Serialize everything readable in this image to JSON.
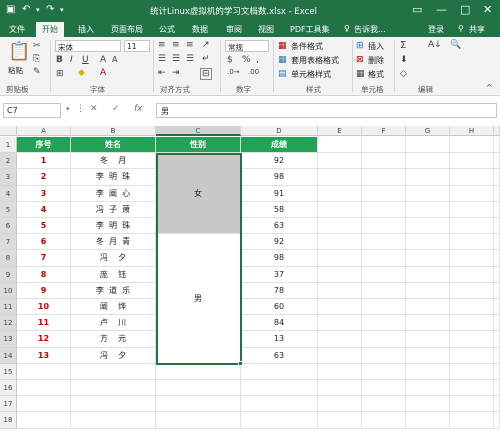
{
  "titlebar": {
    "title": "统计Linux虚拟机的学习文档数.xlsx - Excel",
    "save_icon": "save-icon",
    "undo_icon": "undo-icon",
    "redo_icon": "redo-icon"
  },
  "tabs": [
    "文件",
    "开始",
    "插入",
    "页面布局",
    "公式",
    "数据",
    "审阅",
    "视图",
    "PDF工具集"
  ],
  "tell_me": "告诉我...",
  "login": "登录",
  "share": "共享",
  "ribbon": {
    "paste": "粘贴",
    "font_name": "宋体",
    "font_size": "11",
    "number_format": "常规",
    "percent": "%",
    "conditional_format": "条件格式",
    "table_format": "套用表格格式",
    "cell_style": "单元格样式",
    "insert": "插入",
    "delete": "删除",
    "format": "格式",
    "groups": [
      "剪贴板",
      "字体",
      "对齐方式",
      "数字",
      "样式",
      "单元格",
      "编辑"
    ]
  },
  "formula_bar": {
    "name_box": "C7",
    "fx": "fx",
    "value": "男"
  },
  "columns": [
    "A",
    "B",
    "C",
    "D",
    "E",
    "F",
    "G",
    "H"
  ],
  "rows": [
    "1",
    "2",
    "3",
    "4",
    "5",
    "6",
    "7",
    "8",
    "9",
    "10",
    "11",
    "12",
    "13",
    "14",
    "15",
    "16",
    "17",
    "18"
  ],
  "table": {
    "headers": [
      "序号",
      "姓名",
      "性别",
      "成绩"
    ],
    "ids": [
      "1",
      "2",
      "3",
      "4",
      "5",
      "6",
      "7",
      "8",
      "9",
      "10",
      "11",
      "12",
      "13"
    ],
    "names": [
      "冬    月",
      "李  明  珠",
      "李  阐  心",
      "冯  子  萧",
      "李  明  珠",
      "冬  月  青",
      "冯    夕",
      "庞    钰",
      "李  道  乐",
      "阐    烨",
      "卢    川",
      "方    元",
      "冯    夕"
    ],
    "scores": [
      "92",
      "98",
      "91",
      "58",
      "63",
      "92",
      "98",
      "37",
      "78",
      "60",
      "84",
      "13",
      "63"
    ],
    "gender_female": "女",
    "gender_male": "男"
  },
  "colors": {
    "excel_green": "#217346",
    "header_fill": "#21a255",
    "id_red": "#c00000",
    "merged_gray": "#c8c8c8"
  }
}
